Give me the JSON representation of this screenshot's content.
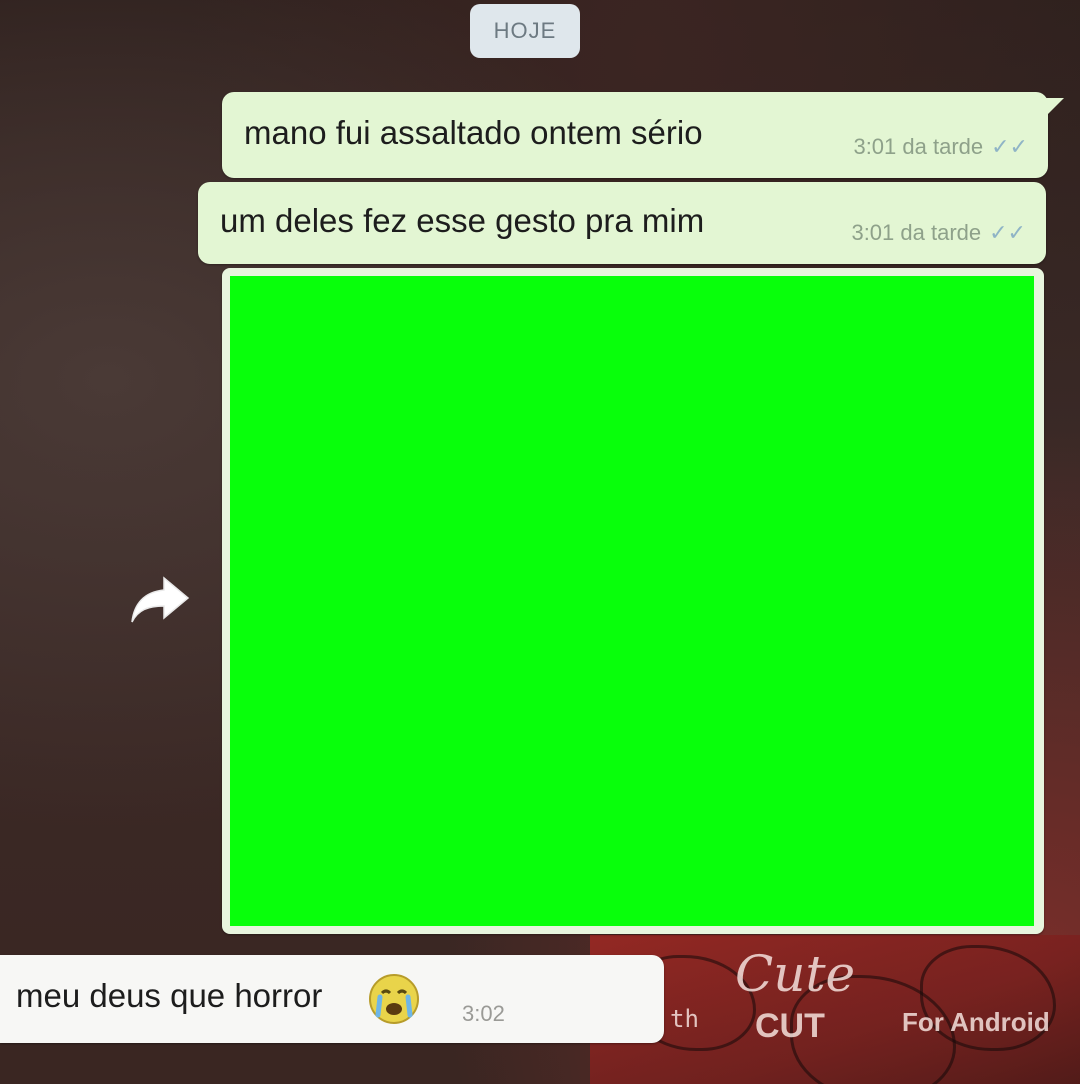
{
  "chat": {
    "date_label": "HOJE",
    "messages": [
      {
        "direction": "outgoing",
        "text": "mano fui assaltado ontem sério",
        "time": "3:01 da tarde",
        "status": "✓✓"
      },
      {
        "direction": "outgoing",
        "text": "um deles fez esse gesto pra mim",
        "time": "3:01 da tarde",
        "status": "✓✓"
      },
      {
        "direction": "outgoing",
        "type": "image",
        "media_color": "#08ff0b"
      },
      {
        "direction": "incoming",
        "text": "meu deus que horror",
        "emoji": "crying-face-icon",
        "time": "3:02"
      }
    ]
  },
  "wallpaper": {
    "caption_left": "th",
    "caption_script": "Cute",
    "caption_logo": "CUT",
    "caption_right": "For Android"
  },
  "colors": {
    "outgoing_bubble": "#e3f6d3",
    "incoming_bubble": "#f7f7f5",
    "date_chip": "#dfe7ec",
    "read_ticks": "#8fb4c6"
  },
  "icons": {
    "share": "forward-arrow-icon",
    "emoji": "crying-face-icon"
  }
}
